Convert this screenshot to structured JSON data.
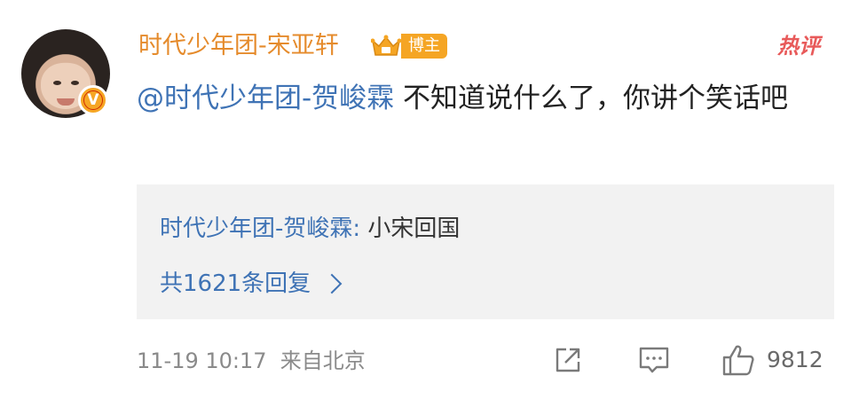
{
  "comment": {
    "username": "时代少年团-宋亚轩",
    "author_badge": "博主",
    "hot_tag": "热评",
    "mention": "@时代少年团-贺峻霖",
    "text": " 不知道说什么了，你讲个笑话吧",
    "avatar_badge": "V"
  },
  "reply": {
    "author": "时代少年团-贺峻霖:",
    "text": " 小宋回国",
    "count_label": "共1621条回复"
  },
  "footer": {
    "timestamp": "11-19 10:17",
    "source": "来自北京",
    "like_count": "9812"
  },
  "icons": {
    "share": "share-icon",
    "comment": "comment-icon",
    "like": "thumbs-up-icon",
    "crown": "crown-icon"
  },
  "colors": {
    "username": "#e58b2c",
    "link": "#3f73b5",
    "badge": "#f5a524",
    "hot": "#e85a5a"
  }
}
